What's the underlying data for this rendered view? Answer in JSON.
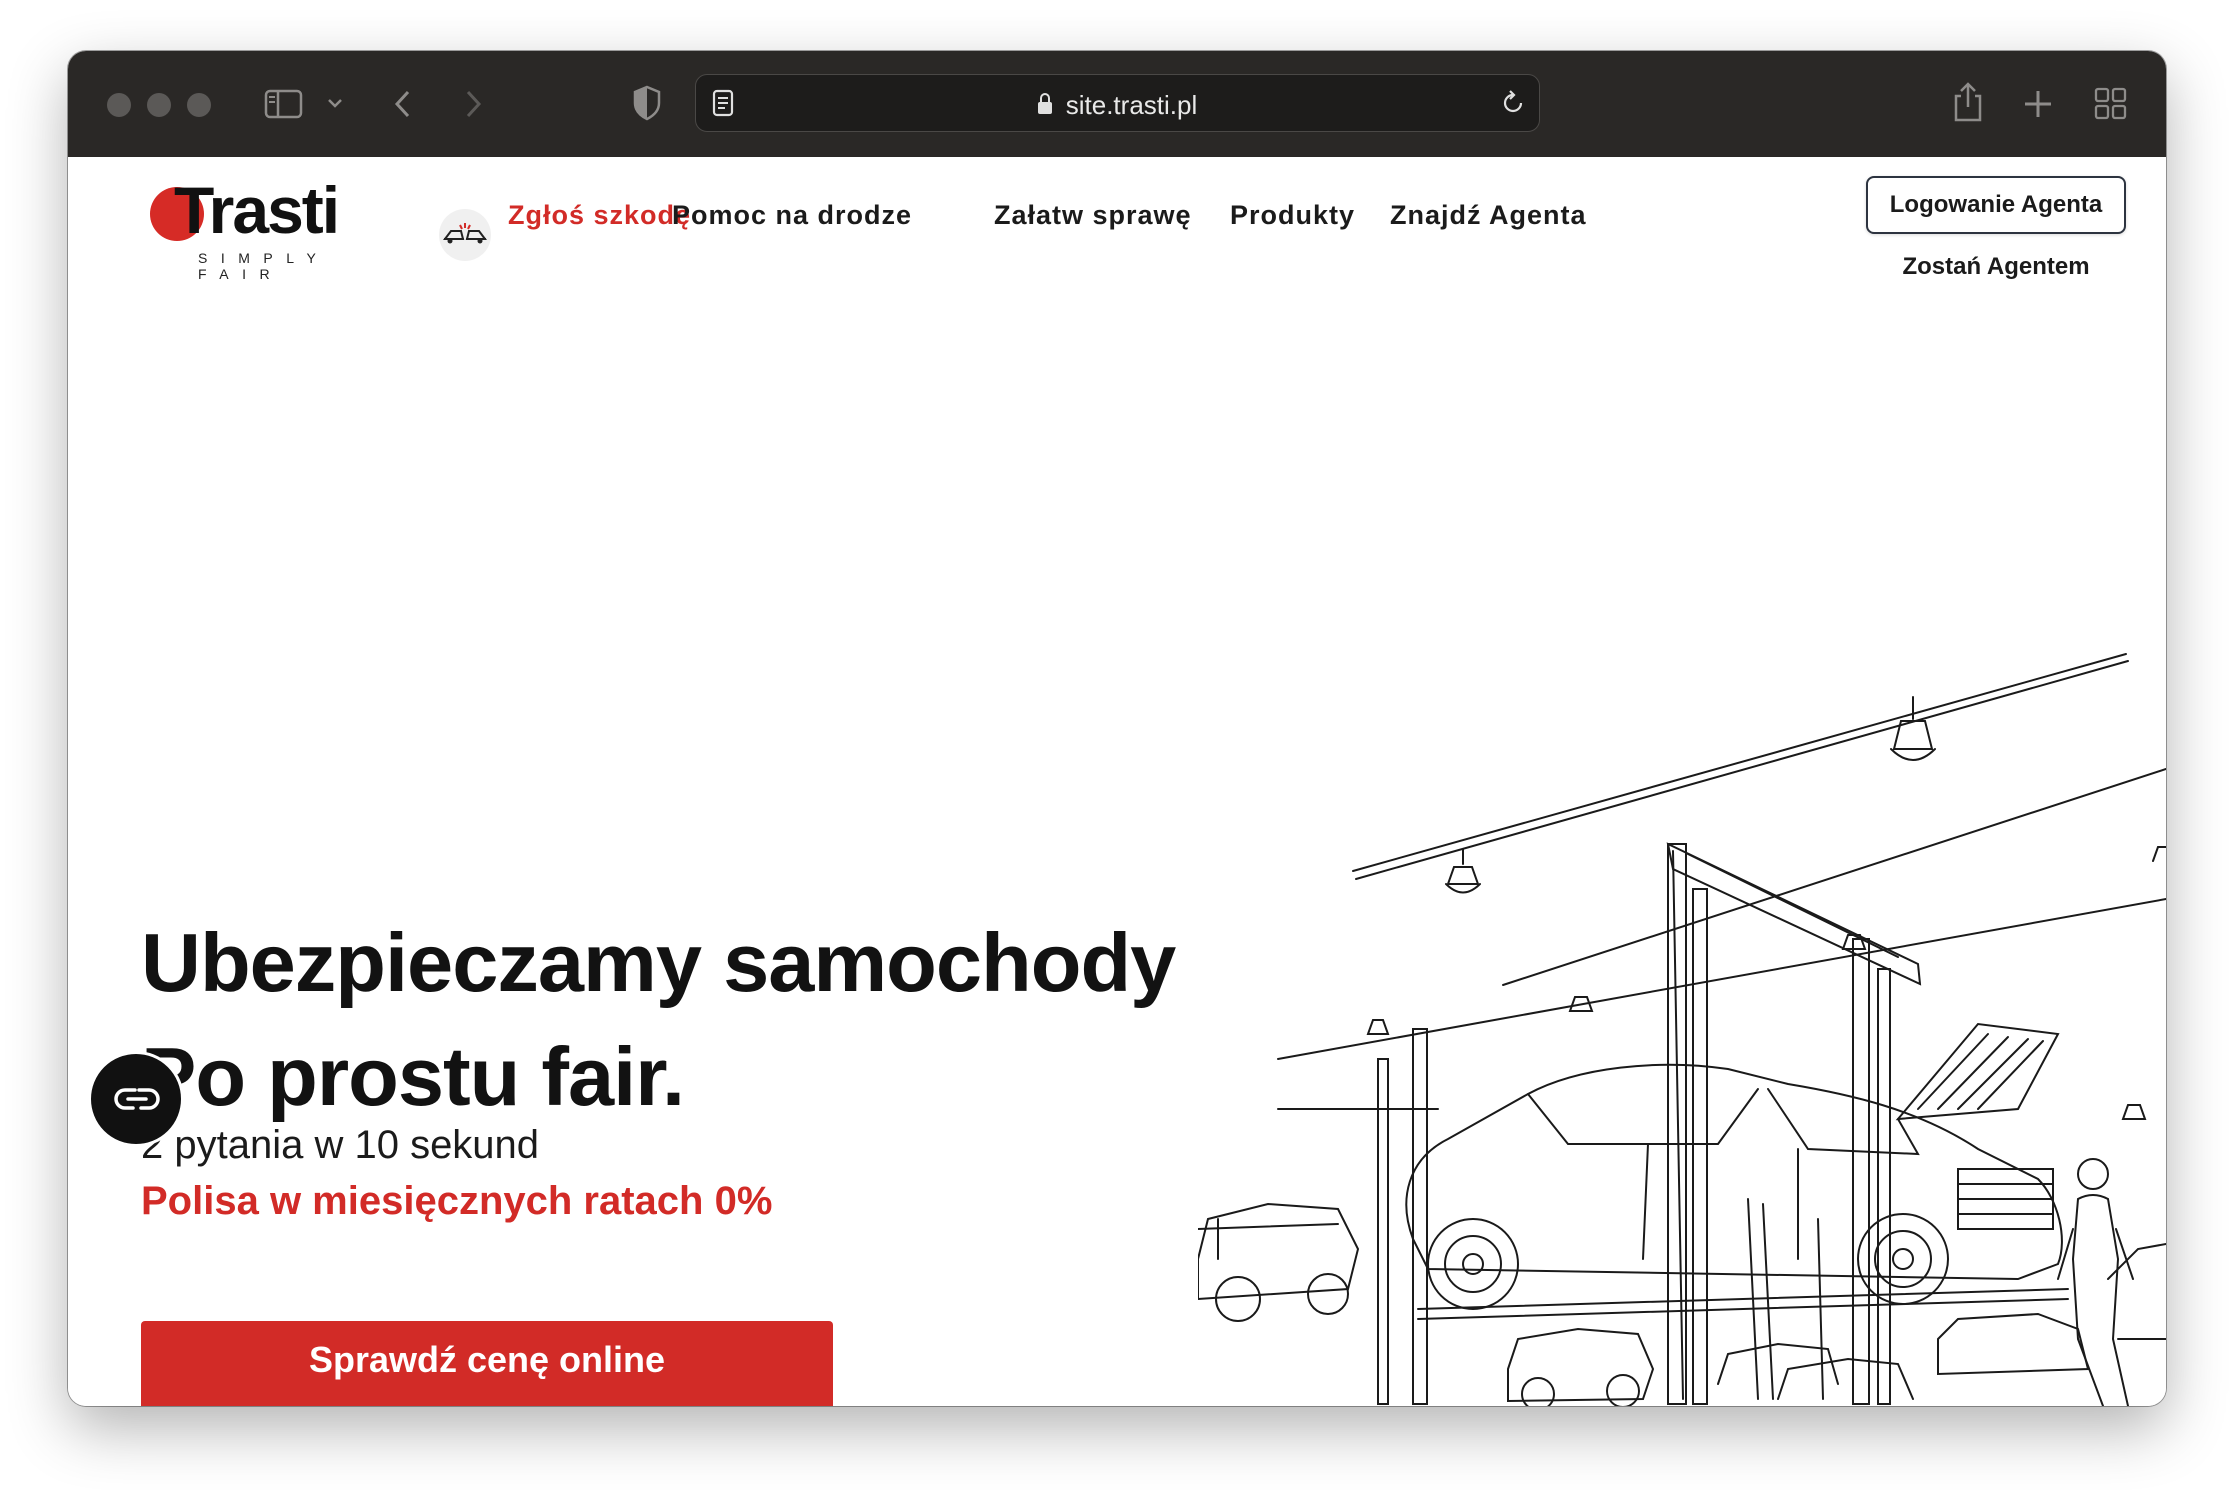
{
  "browser": {
    "url": "site.trasti.pl",
    "icons": [
      "sidebar-icon",
      "chevron-down-icon",
      "back-icon",
      "forward-icon",
      "shield-icon",
      "reader-icon",
      "lock-icon",
      "reload-icon",
      "share-icon",
      "new-tab-icon",
      "tab-overview-icon"
    ]
  },
  "header": {
    "logo": {
      "word": "Trasti",
      "tagline": "SIMPLY FAIR"
    },
    "nav": [
      {
        "label": "Zgłoś szkodę",
        "icon": "car-crash-icon",
        "highlight": true
      },
      {
        "label": "Pomoc na drodze"
      },
      {
        "label": "Załatw sprawę"
      },
      {
        "label": "Produkty"
      },
      {
        "label": "Znajdź Agenta"
      }
    ],
    "agent_login": "Logowanie Agenta",
    "agent_join": "Zostań Agentem"
  },
  "hero": {
    "title_line1": "Ubezpieczamy samochody",
    "title_line2": "Po prostu fair.",
    "subtitle": "2 pytania w 10 sekund",
    "promo": "Polisa w miesięcznych ratach 0%",
    "cta": "Sprawdź cenę online",
    "illustration": "car-workshop-sketch"
  },
  "accessibility_button": {
    "icon": "accessibility-glasses-icon"
  },
  "colors": {
    "accent_red": "#d22b27",
    "toolbar": "#2a2826",
    "text": "#121212"
  }
}
